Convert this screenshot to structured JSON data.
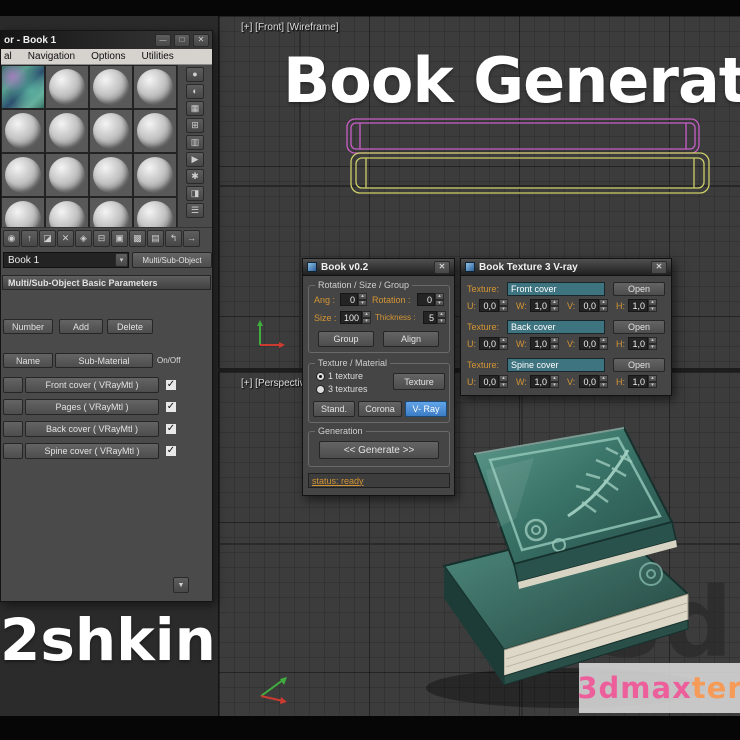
{
  "viewport": {
    "front_label": "[+] [Front] [Wireframe]",
    "persp_label": "[+] [Perspectiv"
  },
  "overlay": {
    "title": "Book Generator",
    "watermark_left": "2shkin",
    "brand_pink": "3dmax",
    "brand_orange": "ter",
    "bg_mark": "3d"
  },
  "colors": {
    "accent_blue": "#4a90d9",
    "label_orange": "#d49534",
    "wire_magenta": "#c95fc9",
    "wire_yellow": "#cdce69",
    "book_teal": "#3a7468"
  },
  "mat_editor": {
    "title": "or - Book 1",
    "win_buttons": {
      "min": "—",
      "max": "□",
      "close": "✕"
    },
    "menu": [
      "al",
      "Navigation",
      "Options",
      "Utilities"
    ],
    "side_icons": [
      {
        "name": "sample-type",
        "glyph": "●"
      },
      {
        "name": "backlight",
        "glyph": "◐"
      },
      {
        "name": "background",
        "glyph": "▦"
      },
      {
        "name": "sample-tiling",
        "glyph": "⊞"
      },
      {
        "name": "video-color-check",
        "glyph": "▥"
      },
      {
        "name": "make-preview",
        "glyph": "▶"
      },
      {
        "name": "options",
        "glyph": "✱"
      },
      {
        "name": "select-by-material",
        "glyph": "◨"
      },
      {
        "name": "material-map-navigator",
        "glyph": "☰"
      }
    ],
    "toolbar_icons": [
      {
        "name": "get-material",
        "glyph": "◉"
      },
      {
        "name": "put-material",
        "glyph": "↑"
      },
      {
        "name": "assign-to-selection",
        "glyph": "◪"
      },
      {
        "name": "reset-map",
        "glyph": "✕"
      },
      {
        "name": "make-unique",
        "glyph": "◈"
      },
      {
        "name": "put-to-library",
        "glyph": "⊟"
      },
      {
        "name": "material-id",
        "glyph": "▣"
      },
      {
        "name": "show-map-in-viewport",
        "glyph": "▩"
      },
      {
        "name": "show-end-result",
        "glyph": "▤"
      },
      {
        "name": "go-to-parent",
        "glyph": "↰"
      },
      {
        "name": "go-forward",
        "glyph": "→"
      }
    ],
    "slot_name": "Book 1",
    "type_button": "Multi/Sub-Object",
    "rollout_title": "Multi/Sub-Object Basic Parameters",
    "number_btn": "Number",
    "add_btn": "Add",
    "delete_btn": "Delete",
    "header_name": "Name",
    "header_sub": "Sub-Material",
    "header_onoff": "On/Off",
    "rows": [
      {
        "label": "Front cover ( VRayMtl )"
      },
      {
        "label": "Pages  ( VRayMtl )"
      },
      {
        "label": "Back cover ( VRayMtl )"
      },
      {
        "label": "Spine cover ( VRayMtl )"
      }
    ]
  },
  "book_dialog": {
    "title": "Book v0.2",
    "close": "✕",
    "rotation_group": {
      "title": "Rotation / Size / Group",
      "ang_label": "Ang :",
      "ang": "0",
      "rot_label": "Rotation :",
      "rot": "0",
      "size_label": "Size :",
      "size": "100",
      "thick_label": "Thickness :",
      "thick": "5",
      "group_btn": "Group",
      "align_btn": "Align"
    },
    "texture_group": {
      "title": "Texture / Material",
      "radio_one": "1 texture",
      "radio_three": "3 textures",
      "texture_btn": "Texture",
      "stand_btn": "Stand.",
      "corona_btn": "Corona",
      "vray_btn": "V- Ray"
    },
    "generation_group": {
      "title": "Generation",
      "generate_btn": "<< Generate >>"
    },
    "status": "status: ready"
  },
  "texture_dialog": {
    "title": "Book Texture 3 V-ray",
    "close": "✕",
    "texture_label": "Texture:",
    "open_btn": "Open",
    "u": "U:",
    "w": "W:",
    "v": "V:",
    "h": "H:",
    "rows": [
      {
        "name": "Front cover",
        "u": "0,0",
        "w": "1,0",
        "v": "0,0",
        "h": "1,0"
      },
      {
        "name": "Back cover",
        "u": "0,0",
        "w": "1,0",
        "v": "0,0",
        "h": "1,0"
      },
      {
        "name": "Spine cover",
        "u": "0,0",
        "w": "1,0",
        "v": "0,0",
        "h": "1,0"
      }
    ]
  },
  "ui": {
    "spin_up": "▴",
    "spin_down": "▾",
    "caret": "▾",
    "check": "✓",
    "scroll_down": "▼"
  }
}
